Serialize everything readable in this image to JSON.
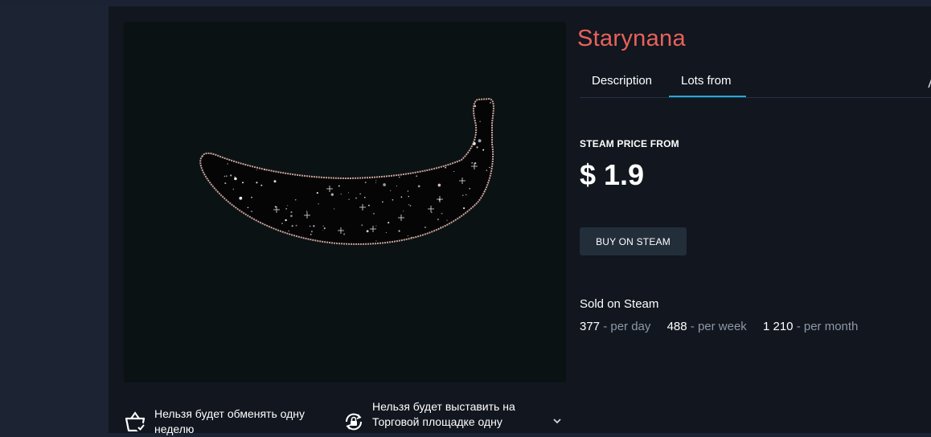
{
  "item": {
    "title": "Starynana"
  },
  "tabs": [
    {
      "label": "Description",
      "active": false
    },
    {
      "label": "Lots from",
      "active": true
    }
  ],
  "price": {
    "label": "STEAM PRICE FROM",
    "value": "$ 1.9"
  },
  "buy_button": {
    "label": "BUY ON STEAM"
  },
  "sales": {
    "title": "Sold on Steam",
    "stats": [
      {
        "value": "377",
        "unit": "- per day"
      },
      {
        "value": "488",
        "unit": "- per week"
      },
      {
        "value": "1 210",
        "unit": "- per month"
      }
    ]
  },
  "notices": {
    "trade": "Нельзя будет обменять одну неделю",
    "market": "Нельзя будет выставить на Торговой площадке одну"
  },
  "colors": {
    "title": "#e8625a",
    "accent_underline": "#23a9d6",
    "panel_bg": "#11161f",
    "page_bg": "#1c2434",
    "muted": "#8e99a6"
  },
  "icons": {
    "trade": "basket-check-icon",
    "market": "lock-cycle-icon",
    "expand": "chevron-down-icon"
  }
}
